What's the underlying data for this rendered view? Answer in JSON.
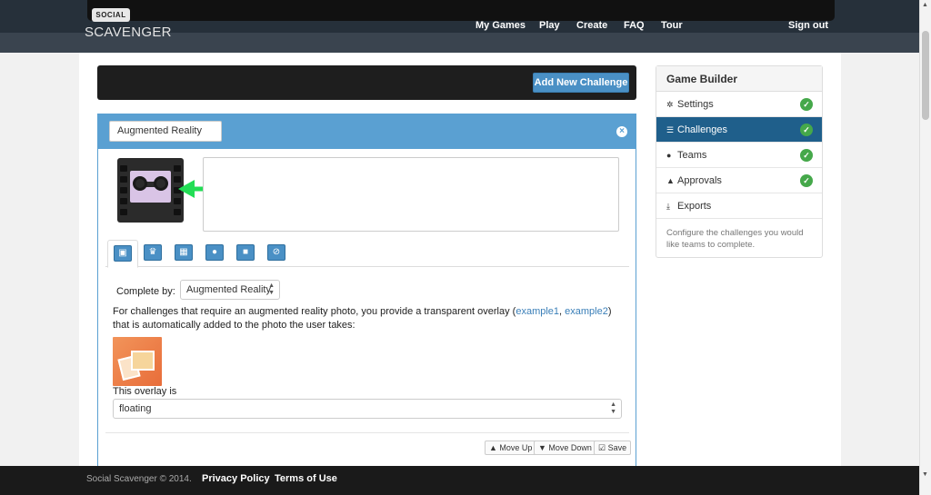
{
  "brand": {
    "badge": "SOCIAL",
    "name": "SCAVENGER"
  },
  "nav": {
    "my_games": "My Games",
    "play": "Play",
    "create": "Create",
    "faq": "FAQ",
    "tour": "Tour",
    "sign_out": "Sign out"
  },
  "toolbar": {
    "add_challenge": "Add New Challenge"
  },
  "challenge": {
    "title": "Augmented Reality",
    "description": "",
    "complete_by_label": "Complete by:",
    "complete_by_value": "Augmented Reality",
    "help_text_1": "For challenges that require an augmented reality photo, you provide a transparent overlay (",
    "example1": "example1",
    "comma": ", ",
    "example2": "example2",
    "help_text_2": ") that is automatically added to the photo the user takes:",
    "overlay_label": "This overlay is",
    "overlay_value": "floating",
    "tabs": [
      "image",
      "trophy",
      "calendar",
      "map-marker",
      "lock",
      "eye-slash"
    ],
    "actions": {
      "move_up": "Move Up",
      "move_down": "Move Down",
      "save": "Save"
    }
  },
  "sidebar": {
    "title": "Game Builder",
    "items": [
      {
        "label": "Settings",
        "icon": "gear-icon",
        "complete": true,
        "active": false
      },
      {
        "label": "Challenges",
        "icon": "list-icon",
        "complete": true,
        "active": true
      },
      {
        "label": "Teams",
        "icon": "user-icon",
        "complete": true,
        "active": false
      },
      {
        "label": "Approvals",
        "icon": "thumbs-up-icon",
        "complete": true,
        "active": false
      },
      {
        "label": "Exports",
        "icon": "download-icon",
        "complete": false,
        "active": false
      }
    ],
    "note": "Configure the challenges you would like teams to complete."
  },
  "footer": {
    "copyright": "Social Scavenger © 2014.",
    "privacy": "Privacy Policy",
    "terms": "Terms of Use"
  },
  "colors": {
    "accent": "#5aa0d2",
    "active_nav": "#1f5f8b",
    "check": "#45a84a",
    "arrow": "#22dd55"
  }
}
